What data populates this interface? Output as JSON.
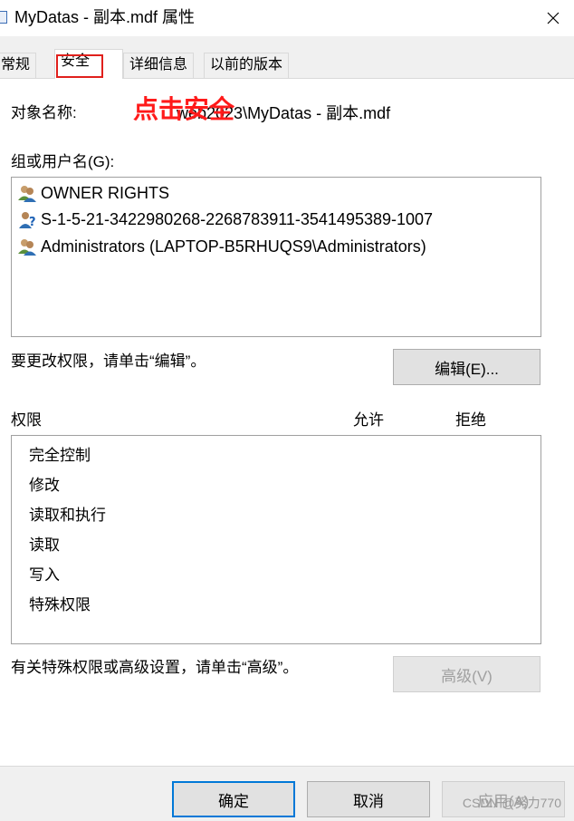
{
  "window": {
    "title": "MyDatas - 副本.mdf 属性",
    "close_icon": "close-icon"
  },
  "tabs": [
    {
      "label": "常规",
      "active": false
    },
    {
      "label": "安全",
      "active": true
    },
    {
      "label": "详细信息",
      "active": false
    },
    {
      "label": "以前的版本",
      "active": false
    }
  ],
  "security": {
    "object_label": "对象名称:",
    "object_value": "...web2023\\MyDatas - 副本.mdf",
    "annotation": "点击安全",
    "group_label": "组或用户名(G):",
    "users": [
      {
        "name": "OWNER RIGHTS",
        "icon": "users-icon"
      },
      {
        "name": "S-1-5-21-3422980268-2268783911-3541495389-1007",
        "icon": "unknown-user-icon"
      },
      {
        "name": "Administrators (LAPTOP-B5RHUQS9\\Administrators)",
        "icon": "users-icon"
      }
    ],
    "change_hint": "要更改权限，请单击“编辑”。",
    "edit_button": "编辑(E)...",
    "perm_header": "权限",
    "allow_header": "允许",
    "deny_header": "拒绝",
    "permissions": [
      "完全控制",
      "修改",
      "读取和执行",
      "读取",
      "写入",
      "特殊权限"
    ],
    "advanced_hint": "有关特殊权限或高级设置，请单击“高级”。",
    "advanced_button": "高级(V)"
  },
  "footer": {
    "ok": "确定",
    "cancel": "取消",
    "apply": "应用(A)"
  },
  "watermark": "CSDN @努力770",
  "colors": {
    "highlight": "#e0201c",
    "annotation": "#ff1a1a",
    "accent": "#0078d7"
  }
}
